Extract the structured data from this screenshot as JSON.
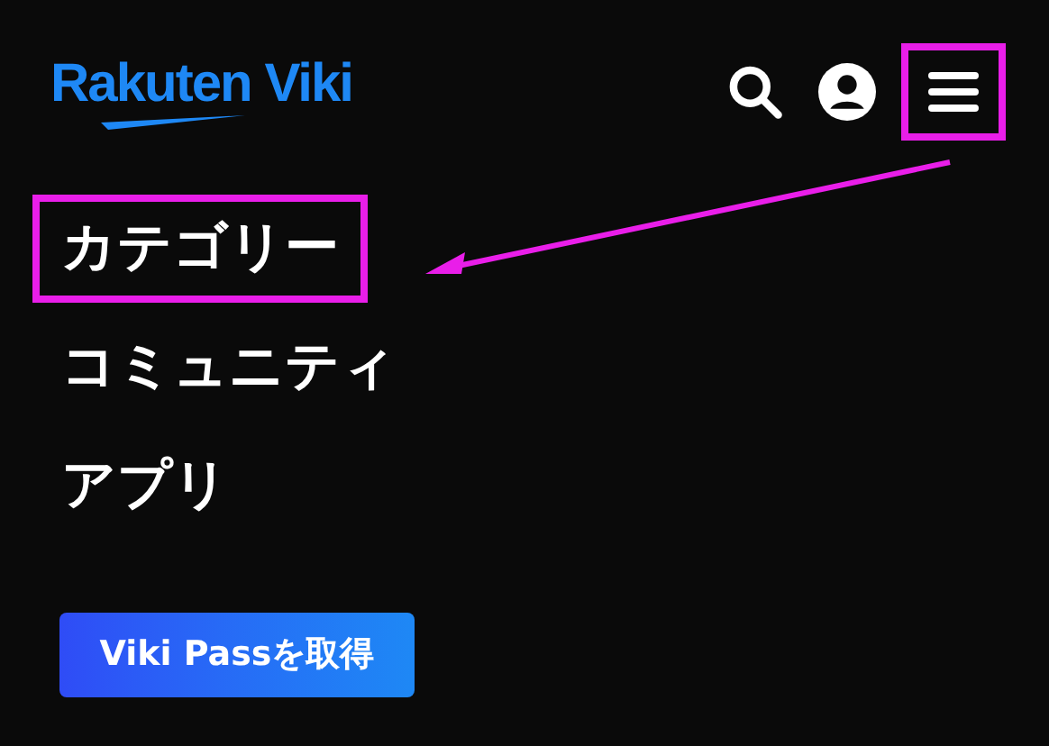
{
  "header": {
    "logo": "Rakuten Viki",
    "menu_button": {
      "highlighted": true
    }
  },
  "menu": {
    "items": [
      {
        "label": "カテゴリー",
        "highlighted": true
      },
      {
        "label": "コミュニティ",
        "highlighted": false
      },
      {
        "label": "アプリ",
        "highlighted": false
      }
    ]
  },
  "cta_button": "Viki Passを取得",
  "annotation": {
    "arrow": true
  }
}
